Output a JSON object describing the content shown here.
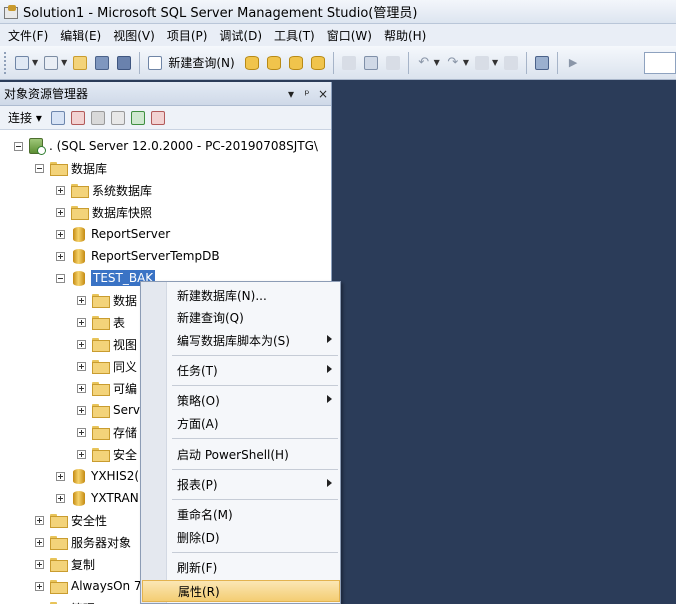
{
  "window": {
    "title": "Solution1 - Microsoft SQL Server Management Studio(管理员)"
  },
  "menubar": [
    {
      "label": "文件(F)"
    },
    {
      "label": "编辑(E)"
    },
    {
      "label": "视图(V)"
    },
    {
      "label": "项目(P)"
    },
    {
      "label": "调试(D)"
    },
    {
      "label": "工具(T)"
    },
    {
      "label": "窗口(W)"
    },
    {
      "label": "帮助(H)"
    }
  ],
  "toolbar": {
    "new_query_label": "新建查询(N)"
  },
  "explorer": {
    "title": "对象资源管理器",
    "connect_label": "连接",
    "pin_glyph": "ᵖ",
    "close_glyph": "×",
    "tree": {
      "server": ". (SQL Server 12.0.2000 - PC-20190708SJTG\\",
      "databases": "数据库",
      "system_dbs": "系统数据库",
      "snapshots": "数据库快照",
      "report_server": "ReportServer",
      "report_server_temp": "ReportServerTempDB",
      "test_bak": "TEST_BAK",
      "children": [
        "数据",
        "表",
        "视图",
        "同义",
        "可编",
        "Serv",
        "存储",
        "安全"
      ],
      "yxhis": "YXHIS2(",
      "yxtran": "YXTRAN",
      "security": "安全性",
      "server_objects": "服务器对象",
      "replication": "复制",
      "alwayson": "AlwaysOn 7",
      "management": "管理"
    }
  },
  "context_menu": {
    "new_database": "新建数据库(N)...",
    "new_query": "新建查询(Q)",
    "script_as": "编写数据库脚本为(S)",
    "tasks": "任务(T)",
    "policies": "策略(O)",
    "facets": "方面(A)",
    "powershell": "启动 PowerShell(H)",
    "reports": "报表(P)",
    "rename": "重命名(M)",
    "delete": "删除(D)",
    "refresh": "刷新(F)",
    "properties": "属性(R)"
  },
  "colors": {
    "workspace": "#2b3c59",
    "selection": "#3a73c5",
    "menu_hover": "#f4cd73"
  }
}
